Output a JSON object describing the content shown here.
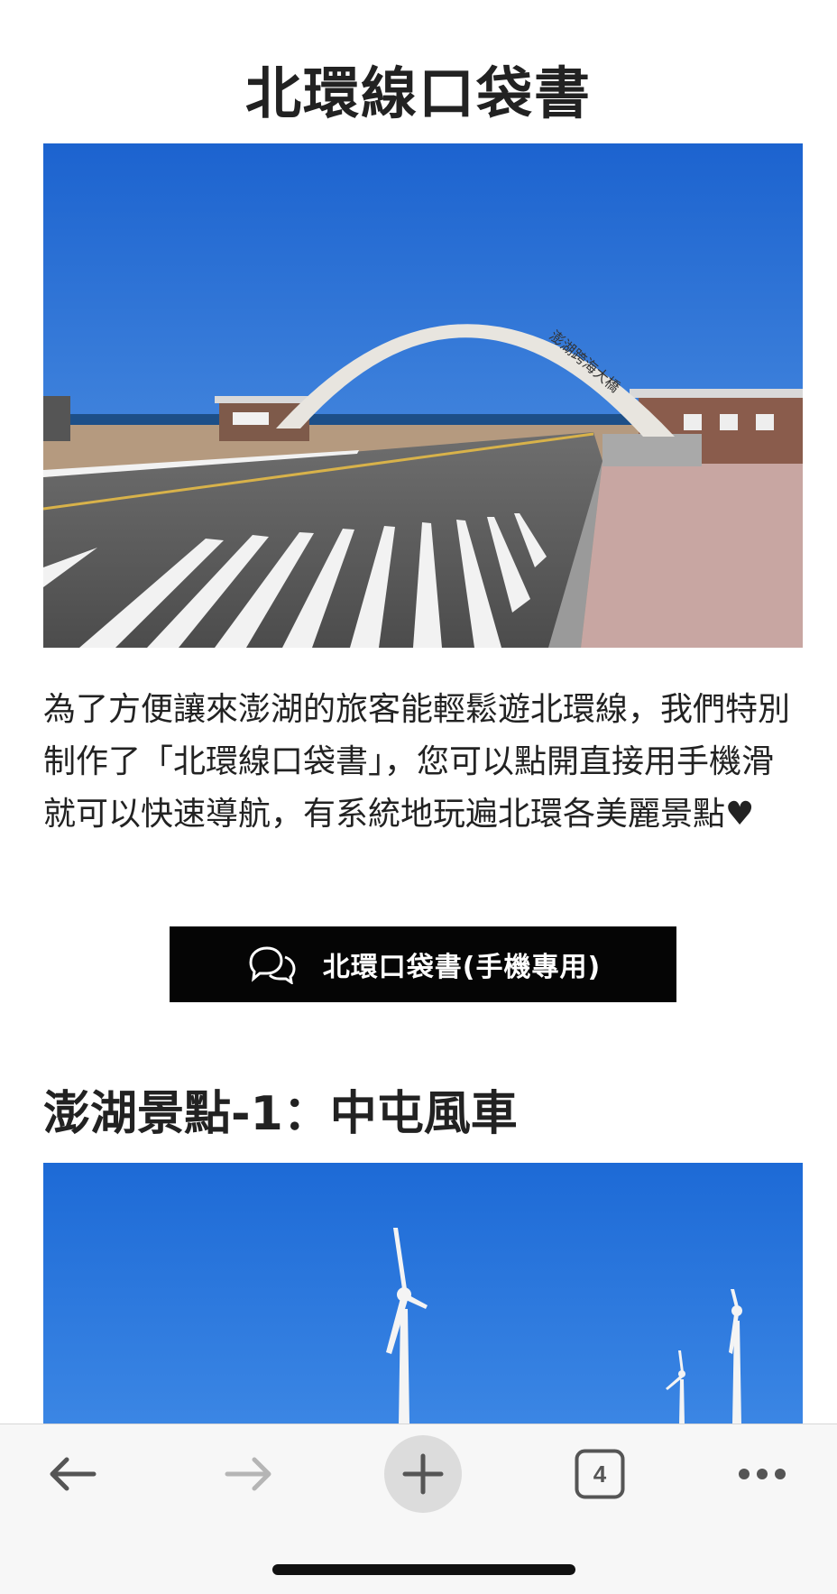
{
  "page": {
    "title": "北環線口袋書",
    "intro": "為了方便讓來澎湖的旅客能輕鬆遊北環線，我們特別制作了「北環線口袋書」，您可以點開直接用手機滑就可以快速導航，有系統地玩遍北環各美麗景點♥",
    "cta_button": {
      "label": "北環口袋書(手機專用)",
      "icon": "chat-bubbles-icon"
    },
    "section_1": {
      "heading": "澎湖景點-1：中屯風車"
    }
  },
  "hero_image": {
    "subject": "arch-bridge-photo",
    "arch_text": "澎湖跨海大橋"
  },
  "browser_toolbar": {
    "back_icon": "arrow-left-icon",
    "forward_icon": "arrow-right-icon",
    "new_tab_icon": "plus-icon",
    "tab_count": "4",
    "more_icon": "more-dots-icon"
  },
  "colors": {
    "sky": "#1f6fd6",
    "button_bg": "#050505",
    "toolbar_bg": "#f7f7f7"
  }
}
